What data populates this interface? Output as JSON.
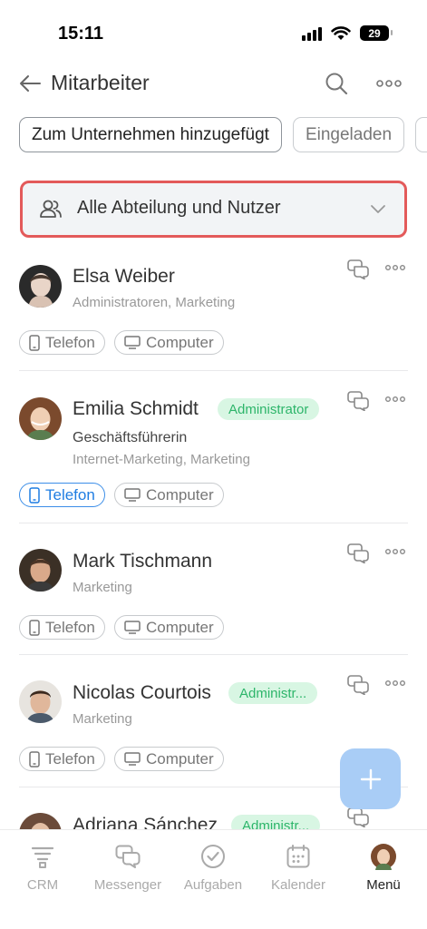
{
  "status": {
    "time": "15:11",
    "battery": "29"
  },
  "header": {
    "title": "Mitarbeiter"
  },
  "tabs": [
    {
      "label": "Zum Unternehmen hinzugefügt",
      "active": true
    },
    {
      "label": "Eingeladen",
      "active": false
    }
  ],
  "department_filter": {
    "label": "Alle Abteilung und Nutzer"
  },
  "chip_labels": {
    "phone": "Telefon",
    "computer": "Computer"
  },
  "employees": [
    {
      "name": "Elsa Weiber",
      "badge": "",
      "role": "",
      "departments": "Administratoren, Marketing",
      "phone_active": false
    },
    {
      "name": "Emilia Schmidt",
      "badge": "Administrator",
      "role": "Geschäftsführerin",
      "departments": "Internet-Marketing, Marketing",
      "phone_active": true
    },
    {
      "name": "Mark Tischmann",
      "badge": "",
      "role": "",
      "departments": "Marketing",
      "phone_active": false
    },
    {
      "name": "Nicolas Courtois",
      "badge": "Administr...",
      "role": "",
      "departments": "Marketing",
      "phone_active": false
    },
    {
      "name": "Adriana Sánchez",
      "badge": "Administr...",
      "role": "",
      "departments": "",
      "phone_active": false
    }
  ],
  "nav": [
    {
      "label": "CRM",
      "icon": "crm-icon",
      "active": false
    },
    {
      "label": "Messenger",
      "icon": "messenger-icon",
      "active": false
    },
    {
      "label": "Aufgaben",
      "icon": "tasks-icon",
      "active": false
    },
    {
      "label": "Kalender",
      "icon": "calendar-icon",
      "active": false
    },
    {
      "label": "Menü",
      "icon": "menu-avatar",
      "active": true
    }
  ],
  "colors": {
    "accent": "#1f7de2",
    "badge_bg": "#d8f6e3",
    "badge_text": "#2db56a",
    "highlight_border": "#e35a5a",
    "fab": "#a9cdf6"
  }
}
